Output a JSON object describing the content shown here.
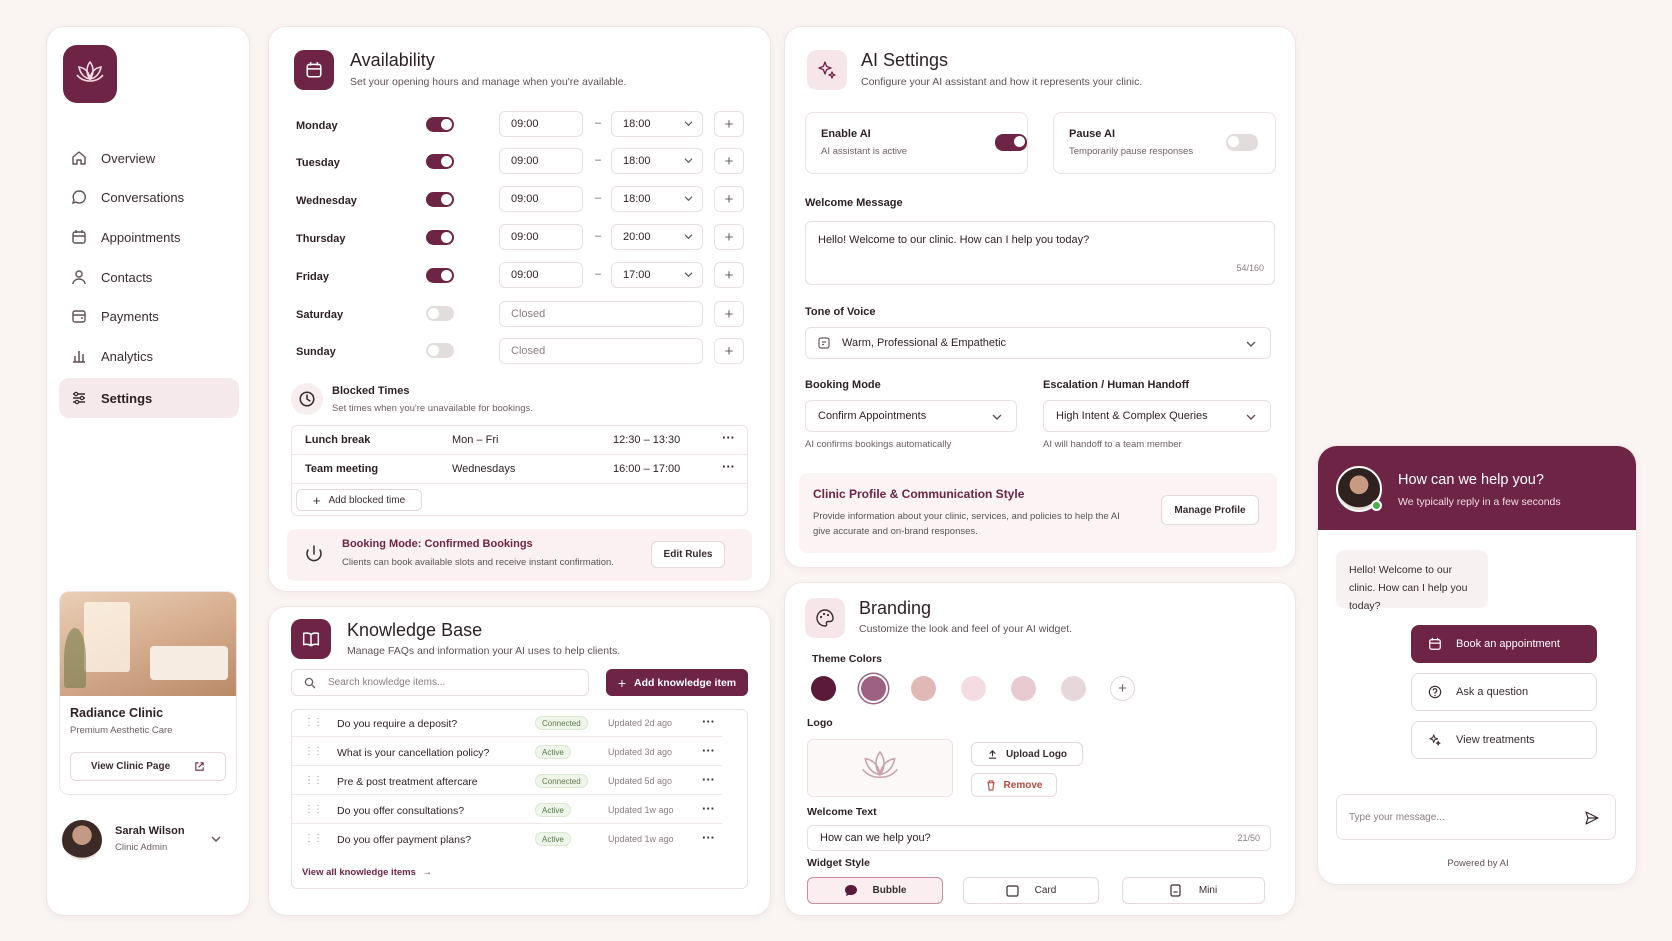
{
  "sidebar": {
    "nav": [
      {
        "label": "Overview",
        "icon": "home-icon"
      },
      {
        "label": "Conversations",
        "icon": "chat-icon"
      },
      {
        "label": "Appointments",
        "icon": "calendar-icon"
      },
      {
        "label": "Contacts",
        "icon": "user-icon"
      },
      {
        "label": "Payments",
        "icon": "wallet-icon"
      },
      {
        "label": "Analytics",
        "icon": "bar-chart-icon"
      },
      {
        "label": "Settings",
        "icon": "sliders-icon",
        "active": true
      }
    ],
    "clinic": {
      "name": "Radiance Clinic",
      "subtitle": "Premium Aesthetic Care",
      "view_label": "View Clinic Page"
    },
    "user": {
      "name": "Sarah Wilson",
      "role": "Clinic Admin"
    }
  },
  "availability": {
    "title": "Availability",
    "subtitle": "Set your opening hours and manage when you're available.",
    "days": [
      {
        "day": "Monday",
        "on": true,
        "start": "09:00",
        "end": "18:00"
      },
      {
        "day": "Tuesday",
        "on": true,
        "start": "09:00",
        "end": "18:00"
      },
      {
        "day": "Wednesday",
        "on": true,
        "start": "09:00",
        "end": "18:00"
      },
      {
        "day": "Thursday",
        "on": true,
        "start": "09:00",
        "end": "20:00"
      },
      {
        "day": "Friday",
        "on": true,
        "start": "09:00",
        "end": "17:00"
      },
      {
        "day": "Saturday",
        "on": false,
        "closed": "Closed"
      },
      {
        "day": "Sunday",
        "on": false,
        "closed": "Closed"
      }
    ],
    "separator": "–",
    "blocked_title": "Blocked Times",
    "blocked_subtitle": "Set times when you're unavailable for bookings.",
    "blocked": [
      {
        "name": "Lunch break",
        "days": "Mon – Fri",
        "time": "12:30 – 13:30"
      },
      {
        "name": "Team meeting",
        "days": "Wednesdays",
        "time": "16:00 – 17:00"
      }
    ],
    "add_blocked": "Add blocked time",
    "booking_mode_title": "Booking Mode: Confirmed Bookings",
    "booking_mode_desc": "Clients can book available slots and receive instant confirmation.",
    "edit_rules": "Edit Rules"
  },
  "knowledge": {
    "title": "Knowledge Base",
    "subtitle": "Manage FAQs and information your AI uses to help clients.",
    "search_placeholder": "Search knowledge items...",
    "add_label": "Add knowledge item",
    "items": [
      {
        "q": "Do you require a deposit?",
        "status": "Connected",
        "updated": "Updated 2d ago"
      },
      {
        "q": "What is your cancellation policy?",
        "status": "Active",
        "updated": "Updated 3d ago"
      },
      {
        "q": "Pre & post treatment aftercare",
        "status": "Connected",
        "updated": "Updated 5d ago"
      },
      {
        "q": "Do you offer consultations?",
        "status": "Active",
        "updated": "Updated 1w ago"
      },
      {
        "q": "Do you offer payment plans?",
        "status": "Active",
        "updated": "Updated 1w ago"
      }
    ],
    "view_all": "View all knowledge items"
  },
  "ai": {
    "title": "AI Settings",
    "subtitle": "Configure your AI assistant and how it represents your clinic.",
    "enable_title": "Enable AI",
    "enable_desc": "AI assistant is active",
    "pause_title": "Pause AI",
    "pause_desc": "Temporarily pause responses",
    "welcome_label": "Welcome Message",
    "welcome_text": "Hello! Welcome to our clinic. How can I help you today?",
    "welcome_count": "54/160",
    "tone_label": "Tone of Voice",
    "tone_value": "Warm, Professional & Empathetic",
    "booking_label": "Booking Mode",
    "booking_value": "Confirm Appointments",
    "booking_hint": "AI confirms bookings automatically",
    "escalation_label": "Escalation / Human Handoff",
    "escalation_value": "High Intent & Complex Queries",
    "escalation_hint": "AI will handoff to a team member",
    "profile_title": "Clinic Profile & Communication Style",
    "profile_desc": "Provide information about your clinic, services, and policies to help the AI give accurate and on-brand responses.",
    "manage_profile": "Manage Profile"
  },
  "branding": {
    "title": "Branding",
    "subtitle": "Customize the look and feel of your AI widget.",
    "theme_label": "Theme Colors",
    "colors": [
      "#5c1a3a",
      "#9c6183",
      "#e0b9b7",
      "#f3dde3",
      "#e8cbd0",
      "#e6d7da"
    ],
    "logo_label": "Logo",
    "upload": "Upload Logo",
    "remove": "Remove",
    "welcome_label": "Welcome Text",
    "welcome_value": "How can we help you?",
    "welcome_count": "21/50",
    "style_label": "Widget Style",
    "styles": [
      "Bubble",
      "Card",
      "Mini"
    ]
  },
  "widget": {
    "title": "How can we help you?",
    "subtitle": "We typically reply in a few seconds",
    "message": "Hello! Welcome to our clinic. How can I help you today?",
    "actions": [
      "Book an appointment",
      "Ask a question",
      "View treatments"
    ],
    "input_placeholder": "Type your message...",
    "powered": "Powered by AI"
  }
}
